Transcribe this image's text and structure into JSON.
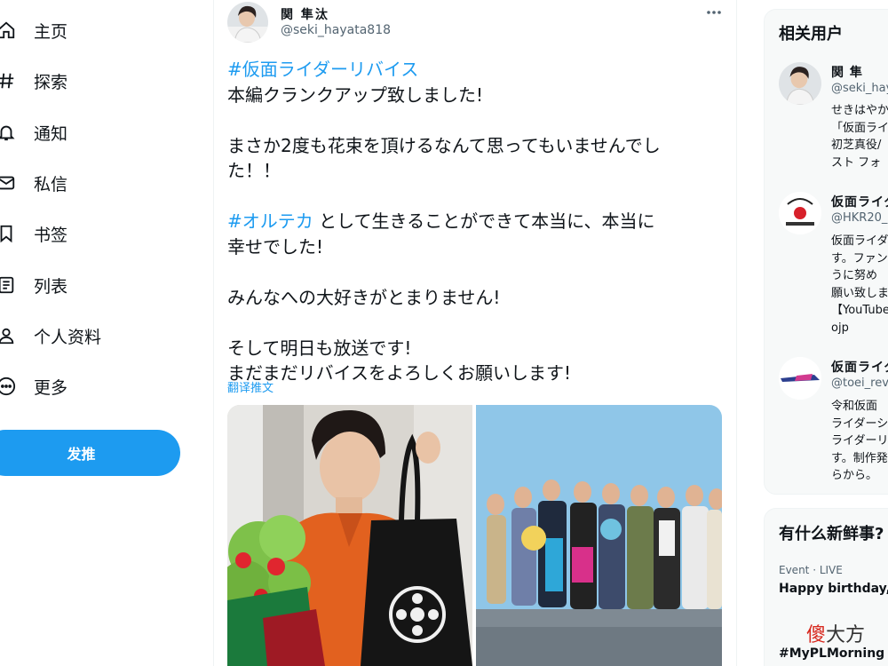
{
  "nav": {
    "items": [
      {
        "label": "主页",
        "icon": "home-icon"
      },
      {
        "label": "探索",
        "icon": "hashtag-icon"
      },
      {
        "label": "通知",
        "icon": "bell-icon"
      },
      {
        "label": "私信",
        "icon": "mail-icon"
      },
      {
        "label": "书签",
        "icon": "bookmark-icon"
      },
      {
        "label": "列表",
        "icon": "list-icon"
      },
      {
        "label": "个人资料",
        "icon": "person-icon"
      },
      {
        "label": "更多",
        "icon": "more-circle-icon"
      }
    ],
    "tweet_button": "发推"
  },
  "tweet": {
    "author_name": "関 隼汰",
    "author_handle": "@seki_hayata818",
    "lines": {
      "l1": "#仮面ライダーリバイス",
      "l2": "本編クランクアップ致しました!",
      "l3": "まさか2度も花束を頂けるなんて思ってもいませんでし",
      "l4": "た！！",
      "l5_tag": "#オルテカ",
      "l5_rest": " として生きることができて本当に、本当に",
      "l6": "幸せでした!",
      "l7": "みんなへの大好きがとまりません!",
      "l8": "そして明日も放送です!",
      "l9": "まだまだリバイスをよろしくお願いします!"
    },
    "translate": "翻译推文"
  },
  "right": {
    "related_title": "相关用户",
    "users": [
      {
        "name": "関 隼",
        "handle": "@seki_hay",
        "bio": "せきはやか\n「仮面ライ\n初芝真役/\nスト フォ"
      },
      {
        "name": "仮面ライダ",
        "handle": "@HKR20_",
        "bio": "仮面ライダ\nす。ファン\nうに努め\n願い致しま\n【YouTube\nojp"
      },
      {
        "name": "仮面ライダ",
        "handle": "@toei_rev",
        "bio": "令和仮面\nライダーシ\nライダーリ\nす。制作発\nらから。"
      }
    ],
    "trends_title": "有什么新鲜事?",
    "trend1_meta": "Event · LIVE",
    "trend1_title": "Happy birthday, J",
    "trend2_title": "#MyPLMorning"
  },
  "watermark": {
    "red": "傻",
    "rest": "大方"
  },
  "colors": {
    "accent": "#1d9bf0",
    "text": "#0f1419",
    "muted": "#536471"
  }
}
